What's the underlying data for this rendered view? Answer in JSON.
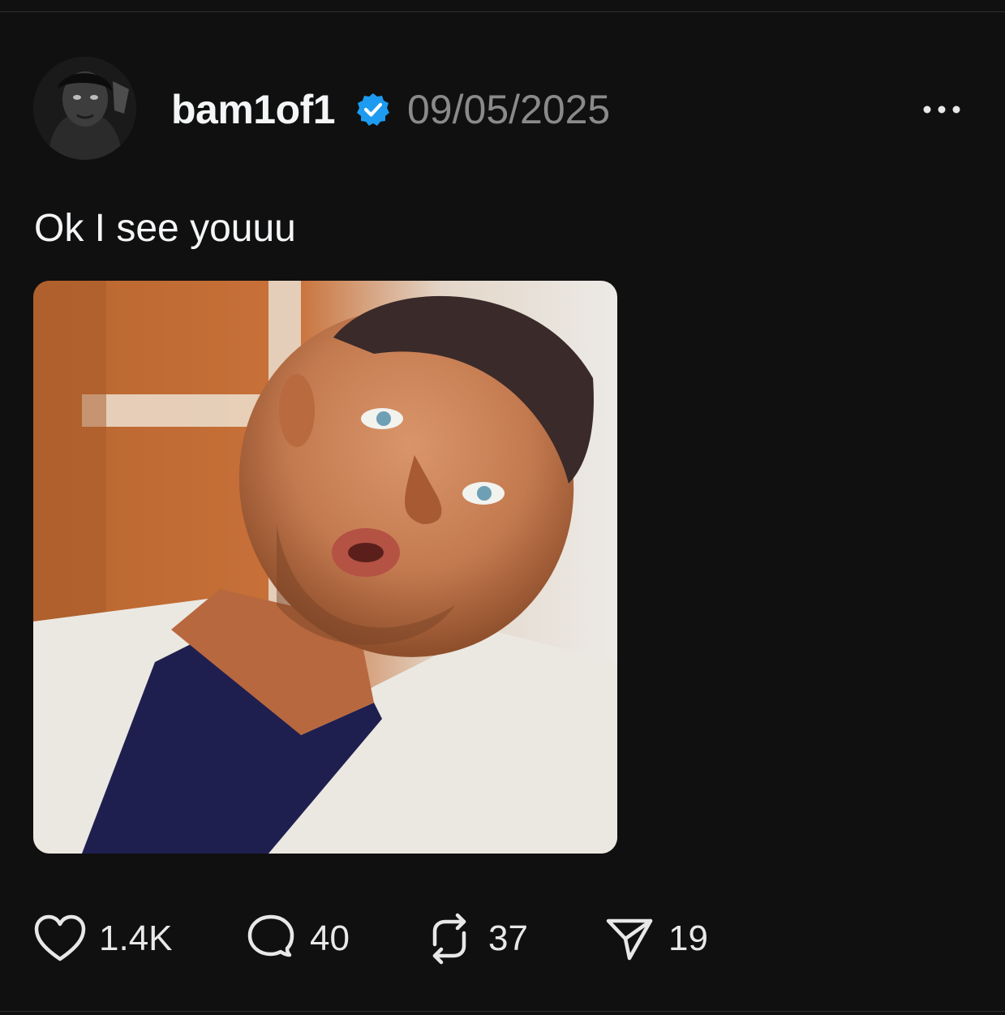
{
  "post": {
    "username": "bam1of1",
    "date": "09/05/2025",
    "text": "Ok I see youuu",
    "verified": true
  },
  "actions": {
    "likes": "1.4K",
    "replies": "40",
    "reposts": "37",
    "shares": "19"
  },
  "icons": {
    "avatar": "profile-photo",
    "verified": "verified-badge-icon",
    "more": "more-options-icon",
    "like": "heart-icon",
    "reply": "comment-bubble-icon",
    "repost": "repost-icon",
    "share": "send-icon"
  },
  "colors": {
    "background": "#101010",
    "text": "#f3f5f7",
    "muted": "#8a8a8a",
    "verified": "#1d9bf0"
  }
}
